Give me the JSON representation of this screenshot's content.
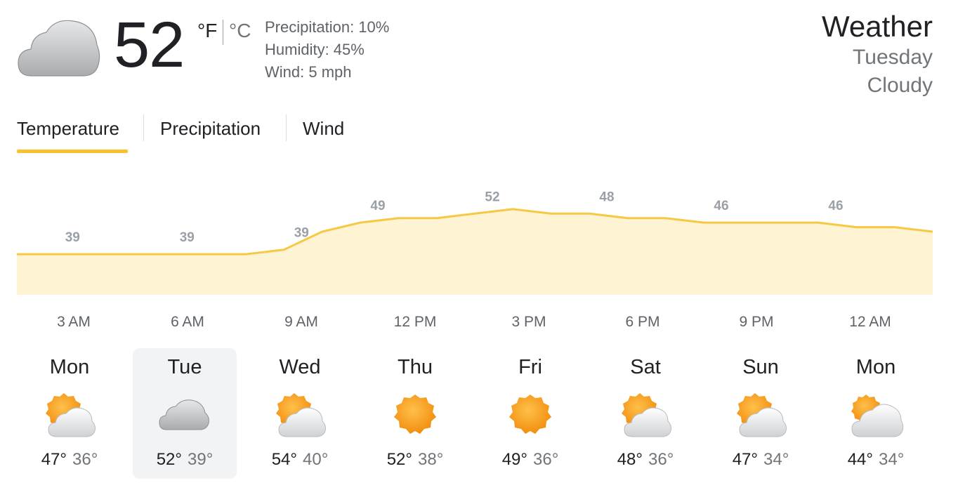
{
  "current": {
    "temperature": "52",
    "unit_f": "°F",
    "unit_c": "°C",
    "icon": "cloudy-icon",
    "precipitation": "Precipitation: 10%",
    "humidity": "Humidity: 45%",
    "wind": "Wind: 5 mph"
  },
  "header": {
    "title": "Weather",
    "day": "Tuesday",
    "condition": "Cloudy"
  },
  "tabs": [
    {
      "label": "Temperature",
      "active": true
    },
    {
      "label": "Precipitation",
      "active": false
    },
    {
      "label": "Wind",
      "active": false
    }
  ],
  "colors": {
    "accent": "#fbc02d",
    "line": "#f6c843",
    "fill": "#fef4d4",
    "selected_day_bg": "#f1f3f4"
  },
  "chart_data": {
    "type": "area",
    "title": "",
    "xlabel": "",
    "ylabel": "",
    "ylim": [
      30,
      58
    ],
    "x": [
      "2 AM",
      "3 AM",
      "4 AM",
      "5 AM",
      "6 AM",
      "7 AM",
      "8 AM",
      "9 AM",
      "10 AM",
      "11 AM",
      "12 PM",
      "1 PM",
      "2 PM",
      "3 PM",
      "4 PM",
      "5 PM",
      "6 PM",
      "7 PM",
      "8 PM",
      "9 PM",
      "10 PM",
      "11 PM",
      "12 AM",
      "1 AM",
      "2 AM"
    ],
    "tick_labels": [
      "3 AM",
      "6 AM",
      "9 AM",
      "12 PM",
      "3 PM",
      "6 PM",
      "9 PM",
      "12 AM"
    ],
    "series": [
      {
        "values": [
          39,
          39,
          39,
          39,
          39,
          39,
          39,
          40,
          44,
          46,
          47,
          47,
          48,
          49,
          48,
          48,
          47,
          47,
          46,
          46,
          46,
          46,
          45,
          45,
          44
        ]
      }
    ],
    "data_labels": [
      {
        "x": "3 AM",
        "value": 39
      },
      {
        "x": "6 AM",
        "value": 39
      },
      {
        "x": "9 AM",
        "value": 39
      },
      {
        "x": "11 AM",
        "value": 49
      },
      {
        "x": "2 PM",
        "value": 52
      },
      {
        "x": "5 PM",
        "value": 48
      },
      {
        "x": "8 PM",
        "value": 46
      },
      {
        "x": "11 PM",
        "value": 46
      }
    ]
  },
  "forecast": [
    {
      "day": "Mon",
      "icon": "partly-cloudy-icon",
      "high": "47°",
      "low": "36°",
      "selected": false
    },
    {
      "day": "Tue",
      "icon": "cloudy-icon",
      "high": "52°",
      "low": "39°",
      "selected": true
    },
    {
      "day": "Wed",
      "icon": "partly-cloudy-icon",
      "high": "54°",
      "low": "40°",
      "selected": false
    },
    {
      "day": "Thu",
      "icon": "sunny-icon",
      "high": "52°",
      "low": "38°",
      "selected": false
    },
    {
      "day": "Fri",
      "icon": "sunny-icon",
      "high": "49°",
      "low": "36°",
      "selected": false
    },
    {
      "day": "Sat",
      "icon": "partly-cloudy-icon",
      "high": "48°",
      "low": "36°",
      "selected": false
    },
    {
      "day": "Sun",
      "icon": "partly-cloudy-icon",
      "high": "47°",
      "low": "34°",
      "selected": false
    },
    {
      "day": "Mon",
      "icon": "mostly-cloudy-icon",
      "high": "44°",
      "low": "34°",
      "selected": false
    }
  ]
}
